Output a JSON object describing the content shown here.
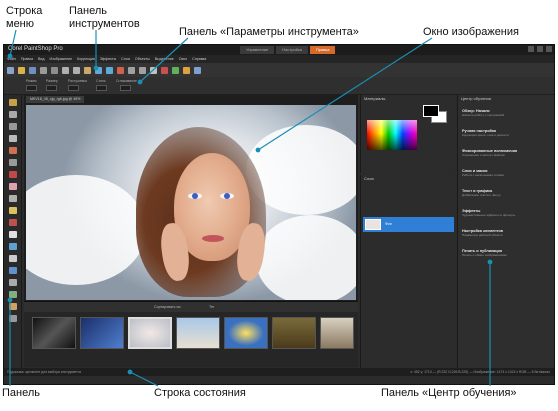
{
  "callouts": {
    "menu_bar": "Строка\nменю",
    "toolbar": "Панель\nинструментов",
    "tool_options": "Панель «Параметры инструмента»",
    "image_window": "Окно изображения",
    "tools_panel": "Панель",
    "status_bar": "Строка состояния",
    "learning_center": "Панель «Центр обучения»"
  },
  "app": {
    "title": "Corel PaintShop Pro",
    "workspace_tabs": [
      "Управление",
      "Настройка",
      "Правка"
    ],
    "active_tab_index": 2,
    "menu": [
      "Файл",
      "Правка",
      "Вид",
      "Изображение",
      "Коррекция",
      "Эффекты",
      "Слои",
      "Объекты",
      "Выделение",
      "Окно",
      "Справка"
    ],
    "image_tab": "MKV18_45_ojp_rgb.jpg @ 45%",
    "materials_title": "Материалы",
    "layers_title": "Слои",
    "layer_name": "Фон",
    "learning_title": "Центр обучения",
    "learning_items": [
      {
        "h": "Обзор: Начало",
        "d": "Начните работу с программой"
      },
      {
        "h": "Ручная настройка",
        "d": "Коррекция цвета, тона и резкости"
      },
      {
        "h": "Фиксированные полномочия",
        "d": "Сохранение и экспорт файлов"
      },
      {
        "h": "Слои и маски",
        "d": "Работа с несколькими слоями"
      },
      {
        "h": "Текст и графика",
        "d": "Добавление текста и фигур"
      },
      {
        "h": "Эффекты",
        "d": "Художественные эффекты и фильтры"
      },
      {
        "h": "Настройка элементов",
        "d": "Параметры рабочей области"
      },
      {
        "h": "Печать и публикация",
        "d": "Печать и обмен изображениями"
      }
    ],
    "organizer_label": "Органайзер",
    "organizer_bar": [
      "Сортировать по:",
      "Тег"
    ],
    "status_left": "Подсказка: щелкните для выбора инструмента",
    "status_right": "x: 452 y: 1710 — (R:232 G:226 B:225) — Изображение: 1474 x 1024 x RGB — 8 бит/канал"
  }
}
